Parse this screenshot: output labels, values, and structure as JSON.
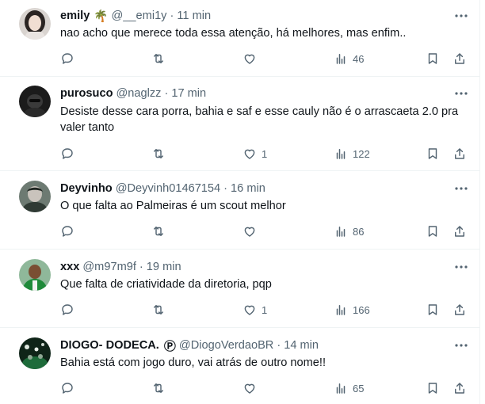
{
  "tweets": [
    {
      "name": "emily",
      "handle": "@__emi1y",
      "time": "11 min",
      "emoji": "🌴",
      "text": "nao acho que merece toda essa atenção, há melhores, mas enfim..",
      "likes": "",
      "views": "46"
    },
    {
      "name": "purosuco",
      "handle": "@naglzz",
      "time": "17 min",
      "text": "Desiste desse cara porra, bahia e saf e esse cauly não é o arrascaeta 2.0 pra valer tanto",
      "likes": "1",
      "views": "122"
    },
    {
      "name": "Deyvinho",
      "handle": "@Deyvinh01467154",
      "time": "16 min",
      "text": "O que falta ao Palmeiras é um scout melhor",
      "likes": "",
      "views": "86"
    },
    {
      "name": "xxx",
      "handle": "@m97m9f",
      "time": "19 min",
      "text": "Que falta de criatividade da diretoria, pqp",
      "likes": "1",
      "views": "166"
    },
    {
      "name": "DIOGO- DODECA.",
      "handle": "@DiogoVerdaoBR",
      "time": "14 min",
      "badge": "Ⓟ",
      "text": "Bahia está com jogo duro, vai atrás de outro nome!!",
      "likes": "",
      "views": "65"
    }
  ],
  "separator": "·",
  "colors": {
    "text": "#0f1419",
    "secondary": "#536471",
    "border": "#eff3f4"
  }
}
